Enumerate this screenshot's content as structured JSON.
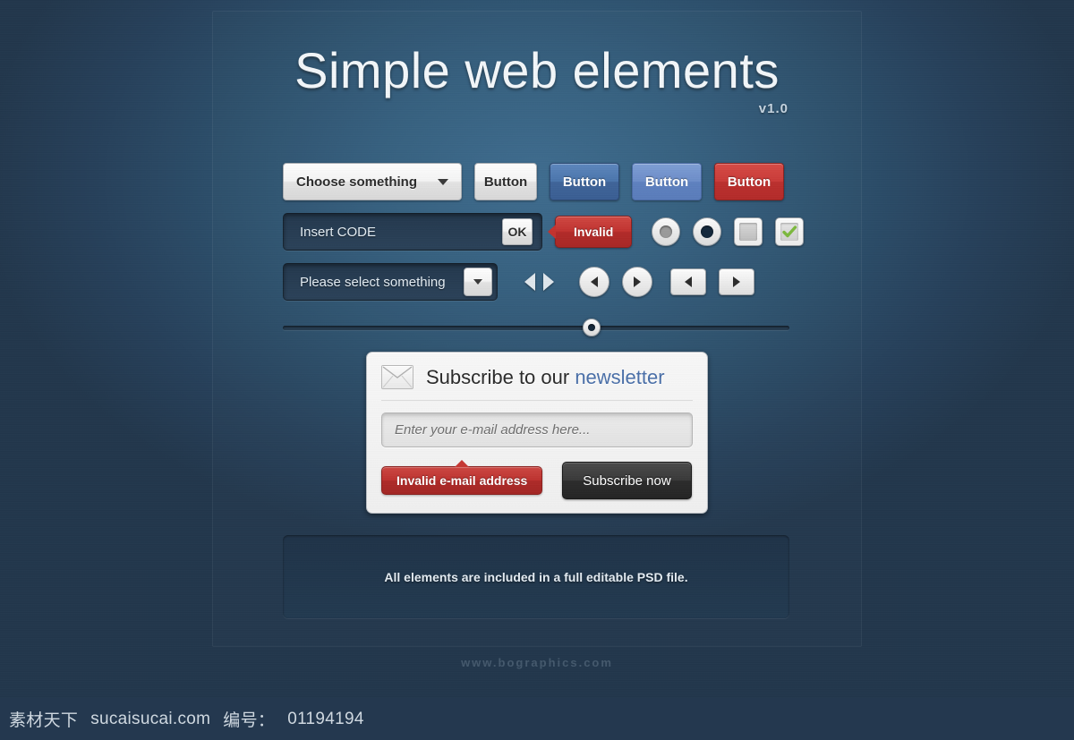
{
  "header": {
    "title": "Simple web elements",
    "version": "v1.0"
  },
  "row1": {
    "select_label": "Choose something",
    "caret_icon": "caret-down-icon",
    "button_plain": "Button",
    "button_blue_dark": "Button",
    "button_blue_light": "Button",
    "button_red": "Button"
  },
  "row2": {
    "code_input_value": "Insert CODE",
    "ok_label": "OK",
    "invalid_tooltip": "Invalid",
    "radio_off_name": "radio-unselected",
    "radio_on_name": "radio-selected",
    "checkbox_off_name": "checkbox-unchecked",
    "checkbox_on_name": "checkbox-checked"
  },
  "row3": {
    "select_value": "Please select something",
    "caret_icon": "caret-down-icon",
    "arrow_prev_flat": "triangle-left-icon",
    "arrow_next_flat": "triangle-right-icon",
    "arrow_prev_round": "circle-arrow-left-icon",
    "arrow_next_round": "circle-arrow-right-icon",
    "arrow_prev_rect": "rect-arrow-left-icon",
    "arrow_next_rect": "rect-arrow-right-icon"
  },
  "slider": {
    "value_percent": 61
  },
  "subscribe": {
    "envelope_icon": "envelope-icon",
    "title_prefix": "Subscribe to our ",
    "title_accent": "newsletter",
    "email_placeholder": "Enter your e-mail address here...",
    "email_value": "",
    "error_badge": "Invalid e-mail address",
    "submit_label": "Subscribe now"
  },
  "note": {
    "text": "All elements are included in a full editable PSD file."
  },
  "watermark": {
    "site": "www.bographics.com"
  },
  "bottom_bar": {
    "brand": "素材天下",
    "domain": "sucaisucai.com",
    "id_label": "编号：",
    "id_value": "01194194"
  },
  "colors": {
    "background": "#24384f",
    "accent_blue": "#4a74ab",
    "accent_blue_light": "#6c8dc8",
    "accent_red": "#c93b38",
    "link_blue": "#4a6fa8",
    "check_green": "#7cb83f",
    "dark_button": "#2c2c2c"
  }
}
